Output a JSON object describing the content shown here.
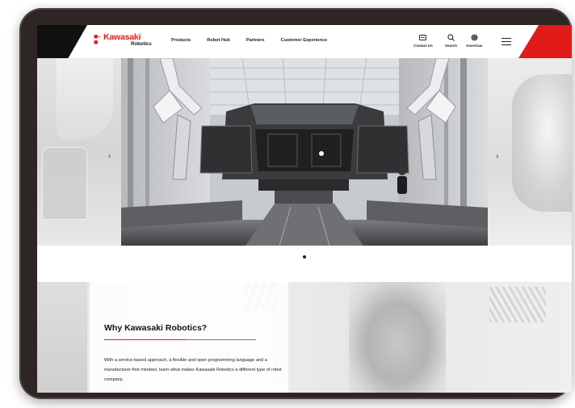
{
  "brand": {
    "mark": "■-■",
    "name": "Kawasaki",
    "sub": "Robotics",
    "accent": "#e11a1a"
  },
  "nav": {
    "items": [
      "Products",
      "Robot Hub",
      "Partners",
      "Customer Experience"
    ]
  },
  "utilities": {
    "contact": {
      "label": "Contact Us",
      "icon": "envelope-icon"
    },
    "search": {
      "label": "Search",
      "icon": "search-icon"
    },
    "region": {
      "label": "Americas",
      "icon": "globe-icon"
    },
    "menu": {
      "icon": "hamburger-menu-icon"
    }
  },
  "carousel": {
    "prev_glyph": "‹",
    "next_glyph": "›",
    "slide_count": 1,
    "active_index": 0
  },
  "why": {
    "title": "Why Kawasaki Robotics?",
    "body": "With a service-based approach, a flexible and open programming language and a manufacturer-first mindset, learn what makes Kawasaki Robotics a different type of robot company."
  }
}
